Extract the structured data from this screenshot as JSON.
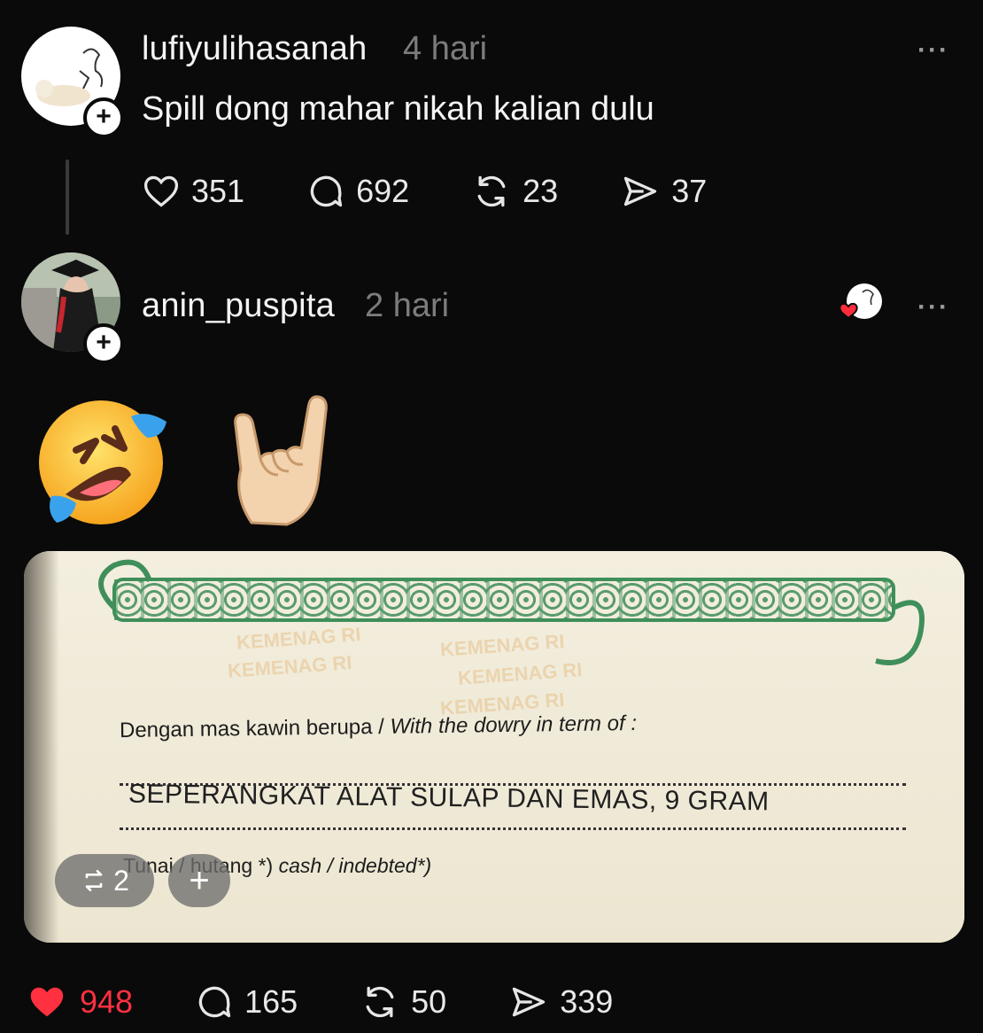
{
  "post1": {
    "username": "lufiyulihasanah",
    "time": "4 hari",
    "text": "Spill dong mahar nikah kalian dulu",
    "more": "···",
    "follow": "+",
    "actions": {
      "likes": "351",
      "comments": "692",
      "reposts": "23",
      "shares": "37"
    }
  },
  "post2": {
    "username": "anin_puspita",
    "time": "2 hari",
    "more": "···",
    "follow": "+",
    "emojis": [
      "rolling-on-floor-laughing",
      "sign-of-the-horns"
    ],
    "image": {
      "label_id": "Dengan mas kawin berupa / ",
      "label_en": "With the dowry in term of :",
      "dowry": "SEPERANGKAT ALAT SULAP DAN EMAS, 9 GRAM",
      "cash_id": "Tunai / hutang *) ",
      "cash_en": "cash / indebted*)",
      "watermark": "KEMENAG RI",
      "repost_count": "2",
      "add": "+"
    },
    "actions": {
      "likes": "948",
      "comments": "165",
      "reposts": "50",
      "shares": "339",
      "liked": true
    }
  },
  "colors": {
    "background": "#0a0a0a",
    "liked": "#ff3040",
    "muted": "#7c7c7c",
    "ornament": "#3f8f5a"
  },
  "icons": [
    "heart-icon",
    "comment-icon",
    "repost-icon",
    "share-icon",
    "more-icon",
    "plus-icon"
  ]
}
